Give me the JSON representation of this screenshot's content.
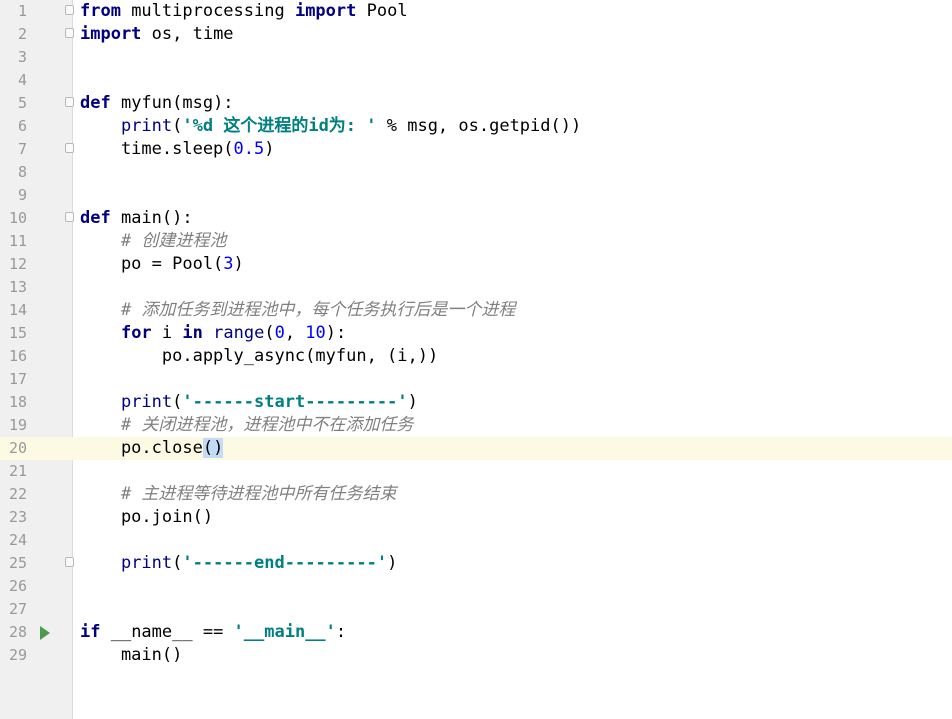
{
  "editor": {
    "current_line": 20,
    "run_line": 28,
    "fold_lines": [
      1,
      2,
      5,
      7,
      10,
      25
    ],
    "lines": [
      {
        "n": "1",
        "tokens": [
          [
            "kw",
            "from"
          ],
          [
            "p",
            " multiprocessing "
          ],
          [
            "kw",
            "import"
          ],
          [
            "p",
            " Pool"
          ]
        ]
      },
      {
        "n": "2",
        "tokens": [
          [
            "kw",
            "import"
          ],
          [
            "p",
            " os, time"
          ]
        ]
      },
      {
        "n": "3",
        "tokens": []
      },
      {
        "n": "4",
        "tokens": []
      },
      {
        "n": "5",
        "tokens": [
          [
            "kw",
            "def"
          ],
          [
            "p",
            " myfun(msg):"
          ]
        ]
      },
      {
        "n": "6",
        "tokens": [
          [
            "p",
            "    "
          ],
          [
            "bi",
            "print"
          ],
          [
            "p",
            "("
          ],
          [
            "str",
            "'%d 这个进程的id为: '"
          ],
          [
            "p",
            " % msg, os.getpid())"
          ]
        ]
      },
      {
        "n": "7",
        "tokens": [
          [
            "p",
            "    time.sleep("
          ],
          [
            "num",
            "0.5"
          ],
          [
            "p",
            ")"
          ]
        ]
      },
      {
        "n": "8",
        "tokens": []
      },
      {
        "n": "9",
        "tokens": []
      },
      {
        "n": "10",
        "tokens": [
          [
            "kw",
            "def"
          ],
          [
            "p",
            " main():"
          ]
        ]
      },
      {
        "n": "11",
        "tokens": [
          [
            "p",
            "    "
          ],
          [
            "cmt",
            "# 创建进程池"
          ]
        ]
      },
      {
        "n": "12",
        "tokens": [
          [
            "p",
            "    po = Pool("
          ],
          [
            "num",
            "3"
          ],
          [
            "p",
            ")"
          ]
        ]
      },
      {
        "n": "13",
        "tokens": []
      },
      {
        "n": "14",
        "tokens": [
          [
            "p",
            "    "
          ],
          [
            "cmt",
            "# 添加任务到进程池中，每个任务执行后是一个进程"
          ]
        ]
      },
      {
        "n": "15",
        "tokens": [
          [
            "p",
            "    "
          ],
          [
            "kw",
            "for"
          ],
          [
            "p",
            " i "
          ],
          [
            "kw",
            "in"
          ],
          [
            "p",
            " "
          ],
          [
            "bi",
            "range"
          ],
          [
            "p",
            "("
          ],
          [
            "num",
            "0"
          ],
          [
            "p",
            ", "
          ],
          [
            "num",
            "10"
          ],
          [
            "p",
            "):"
          ]
        ]
      },
      {
        "n": "16",
        "tokens": [
          [
            "p",
            "        po.apply_async(myfun, (i,))"
          ]
        ]
      },
      {
        "n": "17",
        "tokens": []
      },
      {
        "n": "18",
        "tokens": [
          [
            "p",
            "    "
          ],
          [
            "bi",
            "print"
          ],
          [
            "p",
            "("
          ],
          [
            "str",
            "'------start---------'"
          ],
          [
            "p",
            ")"
          ]
        ]
      },
      {
        "n": "19",
        "tokens": [
          [
            "p",
            "    "
          ],
          [
            "cmt",
            "# 关闭进程池，进程池中不在添加任务"
          ]
        ]
      },
      {
        "n": "20",
        "tokens": [
          [
            "p",
            "    po.close"
          ],
          [
            "caret",
            "()"
          ]
        ]
      },
      {
        "n": "21",
        "tokens": []
      },
      {
        "n": "22",
        "tokens": [
          [
            "p",
            "    "
          ],
          [
            "cmt",
            "# 主进程等待进程池中所有任务结束"
          ]
        ]
      },
      {
        "n": "23",
        "tokens": [
          [
            "p",
            "    po.join()"
          ]
        ]
      },
      {
        "n": "24",
        "tokens": []
      },
      {
        "n": "25",
        "tokens": [
          [
            "p",
            "    "
          ],
          [
            "bi",
            "print"
          ],
          [
            "p",
            "("
          ],
          [
            "str",
            "'------end---------'"
          ],
          [
            "p",
            ")"
          ]
        ]
      },
      {
        "n": "26",
        "tokens": []
      },
      {
        "n": "27",
        "tokens": []
      },
      {
        "n": "28",
        "tokens": [
          [
            "kw",
            "if"
          ],
          [
            "p",
            " __name__ == "
          ],
          [
            "str",
            "'__main__'"
          ],
          [
            "p",
            ":"
          ]
        ]
      },
      {
        "n": "29",
        "tokens": [
          [
            "p",
            "    main()"
          ]
        ]
      }
    ]
  }
}
